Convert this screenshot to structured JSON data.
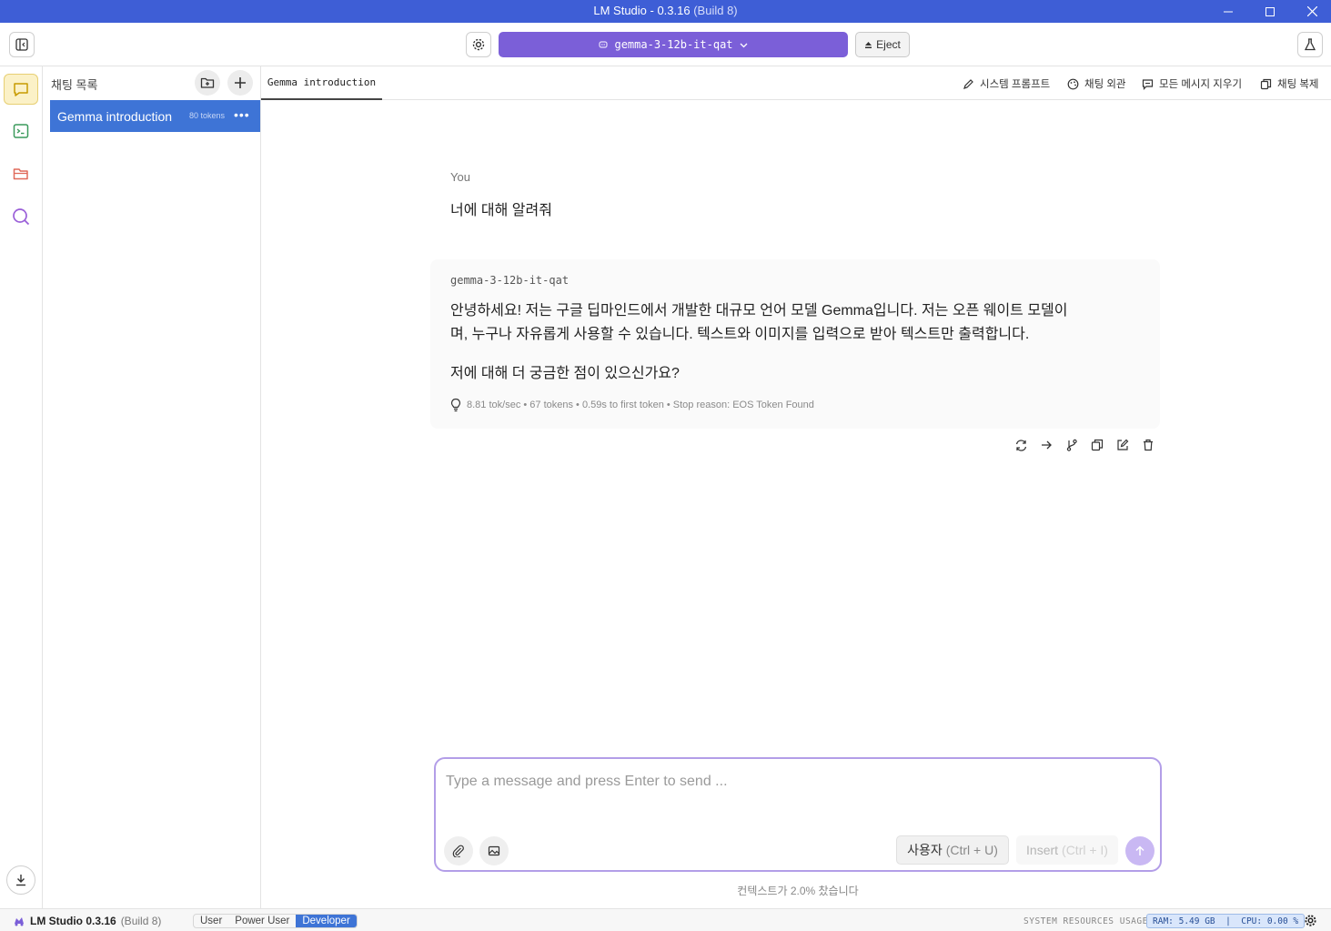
{
  "window": {
    "title": "LM Studio - 0.3.16",
    "build": "(Build 8)"
  },
  "toolbar": {
    "model_name": "gemma-3-12b-it-qat",
    "eject_label": "Eject"
  },
  "chat_list": {
    "header": "채팅 목록",
    "items": [
      {
        "title": "Gemma introduction",
        "tokens": "80 tokens"
      }
    ]
  },
  "tabs": {
    "active": "Gemma introduction",
    "actions": [
      "시스템 프롬프트",
      "채팅 외관",
      "모든 메시지 지우기",
      "채팅 복제"
    ]
  },
  "conversation": {
    "user_sender": "You",
    "user_message": "너에 대해 알려줘",
    "assistant_sender": "gemma-3-12b-it-qat",
    "assistant_paragraph_1_line_1": "안녕하세요! 저는 구글 딥마인드에서 개발한 대규모 언어 모델 Gemma입니다. 저는 오픈 웨이트 모델이",
    "assistant_paragraph_1_line_2": "며, 누구나 자유롭게 사용할 수 있습니다. 텍스트와 이미지를 입력으로 받아 텍스트만 출력합니다.",
    "assistant_paragraph_2": "저에 대해 더 궁금한 점이 있으신가요?",
    "stats": "8.81 tok/sec • 67 tokens • 0.59s to first token • Stop reason: EOS Token Found"
  },
  "composer": {
    "placeholder": "Type a message and press Enter to send ...",
    "role_label": "사용자",
    "role_shortcut": "(Ctrl + U)",
    "insert_label": "Insert",
    "insert_shortcut": "(Ctrl + I)"
  },
  "context_note": "컨텍스트가 2.0% 찼습니다",
  "status_bar": {
    "app_name": "LM Studio 0.3.16",
    "build": "(Build 8)",
    "modes": [
      "User",
      "Power User",
      "Developer"
    ],
    "active_mode": "Developer",
    "resources_label": "SYSTEM RESOURCES USAGE:",
    "resources_value": "RAM: 5.49 GB  |  CPU: 0.00 %"
  },
  "colors": {
    "titlebar": "#3e5ed6",
    "model_select": "#7b5fd8",
    "selected_chat": "#3e74d6",
    "composer_border": "#b39ee8"
  }
}
